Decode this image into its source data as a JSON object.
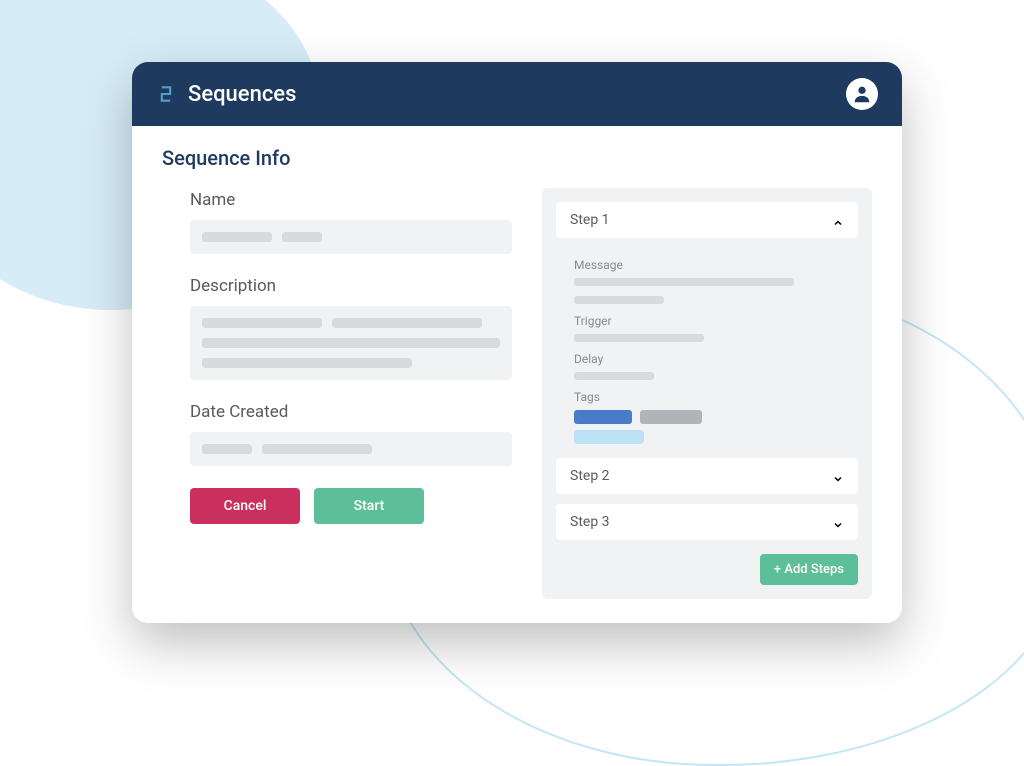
{
  "header": {
    "app_title": "Sequences"
  },
  "page": {
    "section_title": "Sequence Info"
  },
  "fields": {
    "name_label": "Name",
    "description_label": "Description",
    "date_created_label": "Date Created"
  },
  "buttons": {
    "cancel": "Cancel",
    "start": "Start",
    "add_steps": "+ Add Steps"
  },
  "steps": {
    "step1": {
      "title": "Step 1",
      "expanded": true,
      "fields": {
        "message": "Message",
        "trigger": "Trigger",
        "delay": "Delay",
        "tags": "Tags"
      }
    },
    "step2": {
      "title": "Step 2",
      "expanded": false
    },
    "step3": {
      "title": "Step 3",
      "expanded": false
    }
  }
}
